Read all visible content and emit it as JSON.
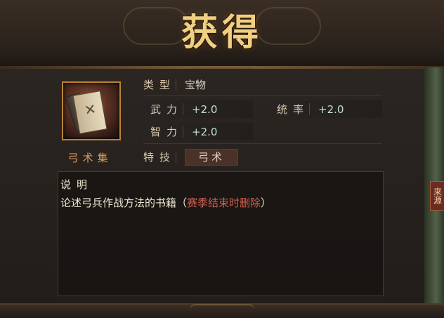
{
  "banner": {
    "title": "获得"
  },
  "item": {
    "name": "弓术集",
    "icon": "book-icon"
  },
  "attributes": {
    "type": {
      "label": "类型",
      "value": "宝物"
    },
    "force": {
      "label": "武力",
      "value": "+2.0"
    },
    "command": {
      "label": "统率",
      "value": "+2.0"
    },
    "intelligence": {
      "label": "智力",
      "value": "+2.0"
    },
    "skill": {
      "label": "特技",
      "value": "弓术"
    }
  },
  "description": {
    "title": "说明",
    "text": "论述弓兵作战方法的书籍（",
    "highlight": "赛季结束时删除",
    "text_end": "）"
  },
  "side_tab": {
    "label": "来源"
  },
  "colors": {
    "title": "#f0cf82",
    "stat_value": "#bfe0cc",
    "highlight": "#d15d4e",
    "item_name": "#d59a59"
  }
}
